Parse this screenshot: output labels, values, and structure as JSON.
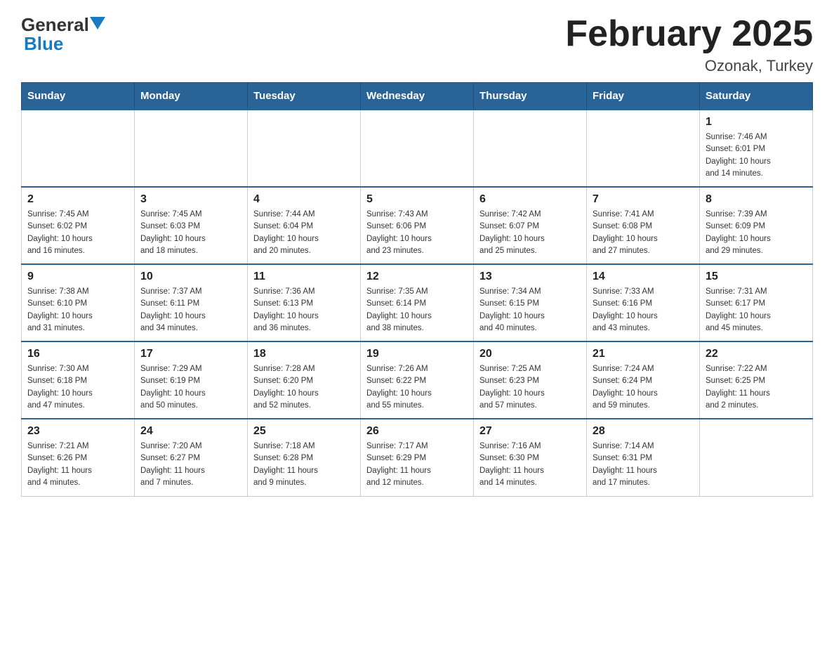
{
  "header": {
    "logo_general": "General",
    "logo_blue": "Blue",
    "month_title": "February 2025",
    "location": "Ozonak, Turkey"
  },
  "weekdays": [
    "Sunday",
    "Monday",
    "Tuesday",
    "Wednesday",
    "Thursday",
    "Friday",
    "Saturday"
  ],
  "weeks": [
    [
      {
        "day": "",
        "info": ""
      },
      {
        "day": "",
        "info": ""
      },
      {
        "day": "",
        "info": ""
      },
      {
        "day": "",
        "info": ""
      },
      {
        "day": "",
        "info": ""
      },
      {
        "day": "",
        "info": ""
      },
      {
        "day": "1",
        "info": "Sunrise: 7:46 AM\nSunset: 6:01 PM\nDaylight: 10 hours\nand 14 minutes."
      }
    ],
    [
      {
        "day": "2",
        "info": "Sunrise: 7:45 AM\nSunset: 6:02 PM\nDaylight: 10 hours\nand 16 minutes."
      },
      {
        "day": "3",
        "info": "Sunrise: 7:45 AM\nSunset: 6:03 PM\nDaylight: 10 hours\nand 18 minutes."
      },
      {
        "day": "4",
        "info": "Sunrise: 7:44 AM\nSunset: 6:04 PM\nDaylight: 10 hours\nand 20 minutes."
      },
      {
        "day": "5",
        "info": "Sunrise: 7:43 AM\nSunset: 6:06 PM\nDaylight: 10 hours\nand 23 minutes."
      },
      {
        "day": "6",
        "info": "Sunrise: 7:42 AM\nSunset: 6:07 PM\nDaylight: 10 hours\nand 25 minutes."
      },
      {
        "day": "7",
        "info": "Sunrise: 7:41 AM\nSunset: 6:08 PM\nDaylight: 10 hours\nand 27 minutes."
      },
      {
        "day": "8",
        "info": "Sunrise: 7:39 AM\nSunset: 6:09 PM\nDaylight: 10 hours\nand 29 minutes."
      }
    ],
    [
      {
        "day": "9",
        "info": "Sunrise: 7:38 AM\nSunset: 6:10 PM\nDaylight: 10 hours\nand 31 minutes."
      },
      {
        "day": "10",
        "info": "Sunrise: 7:37 AM\nSunset: 6:11 PM\nDaylight: 10 hours\nand 34 minutes."
      },
      {
        "day": "11",
        "info": "Sunrise: 7:36 AM\nSunset: 6:13 PM\nDaylight: 10 hours\nand 36 minutes."
      },
      {
        "day": "12",
        "info": "Sunrise: 7:35 AM\nSunset: 6:14 PM\nDaylight: 10 hours\nand 38 minutes."
      },
      {
        "day": "13",
        "info": "Sunrise: 7:34 AM\nSunset: 6:15 PM\nDaylight: 10 hours\nand 40 minutes."
      },
      {
        "day": "14",
        "info": "Sunrise: 7:33 AM\nSunset: 6:16 PM\nDaylight: 10 hours\nand 43 minutes."
      },
      {
        "day": "15",
        "info": "Sunrise: 7:31 AM\nSunset: 6:17 PM\nDaylight: 10 hours\nand 45 minutes."
      }
    ],
    [
      {
        "day": "16",
        "info": "Sunrise: 7:30 AM\nSunset: 6:18 PM\nDaylight: 10 hours\nand 47 minutes."
      },
      {
        "day": "17",
        "info": "Sunrise: 7:29 AM\nSunset: 6:19 PM\nDaylight: 10 hours\nand 50 minutes."
      },
      {
        "day": "18",
        "info": "Sunrise: 7:28 AM\nSunset: 6:20 PM\nDaylight: 10 hours\nand 52 minutes."
      },
      {
        "day": "19",
        "info": "Sunrise: 7:26 AM\nSunset: 6:22 PM\nDaylight: 10 hours\nand 55 minutes."
      },
      {
        "day": "20",
        "info": "Sunrise: 7:25 AM\nSunset: 6:23 PM\nDaylight: 10 hours\nand 57 minutes."
      },
      {
        "day": "21",
        "info": "Sunrise: 7:24 AM\nSunset: 6:24 PM\nDaylight: 10 hours\nand 59 minutes."
      },
      {
        "day": "22",
        "info": "Sunrise: 7:22 AM\nSunset: 6:25 PM\nDaylight: 11 hours\nand 2 minutes."
      }
    ],
    [
      {
        "day": "23",
        "info": "Sunrise: 7:21 AM\nSunset: 6:26 PM\nDaylight: 11 hours\nand 4 minutes."
      },
      {
        "day": "24",
        "info": "Sunrise: 7:20 AM\nSunset: 6:27 PM\nDaylight: 11 hours\nand 7 minutes."
      },
      {
        "day": "25",
        "info": "Sunrise: 7:18 AM\nSunset: 6:28 PM\nDaylight: 11 hours\nand 9 minutes."
      },
      {
        "day": "26",
        "info": "Sunrise: 7:17 AM\nSunset: 6:29 PM\nDaylight: 11 hours\nand 12 minutes."
      },
      {
        "day": "27",
        "info": "Sunrise: 7:16 AM\nSunset: 6:30 PM\nDaylight: 11 hours\nand 14 minutes."
      },
      {
        "day": "28",
        "info": "Sunrise: 7:14 AM\nSunset: 6:31 PM\nDaylight: 11 hours\nand 17 minutes."
      },
      {
        "day": "",
        "info": ""
      }
    ]
  ]
}
